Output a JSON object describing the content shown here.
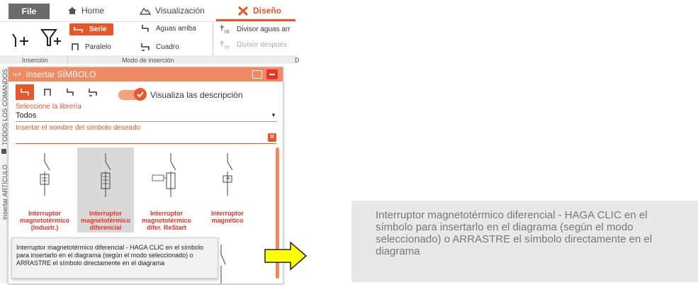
{
  "ribbon": {
    "file_tab": "File",
    "tabs": [
      {
        "label": "Home",
        "icon": "home-icon"
      },
      {
        "label": "Visualización",
        "icon": "mountain-icon"
      },
      {
        "label": "Diseño",
        "icon": "tools-icon"
      }
    ],
    "insert_mode_options": {
      "serie": "Serie",
      "paralelo": "Paralelo",
      "aguas_arriba": "Aguas arriba",
      "cuadro": "Cuadro",
      "divisor_aguas_arriba": "Divisor aguas arr",
      "divisor_despues": "Divisor después"
    },
    "groups": {
      "insercion": "Inserción",
      "modo_insercion": "Modo de inserción"
    }
  },
  "side_tabs": {
    "commands": "TODOS LOS COMANDOS",
    "insert_article": "Insertar ARTÍCULO"
  },
  "panel": {
    "title": "Insertar SÍMBOLO",
    "toggle_label": "Visualiza las descripción",
    "library_label": "Seleccione la librería",
    "library_value": "Todos",
    "search_placeholder": "Insertar el nombre del símbolo deseado",
    "symbols": [
      {
        "name_lines": [
          "Interruptor",
          "magnetotérmico",
          "(Industr.)"
        ]
      },
      {
        "name_lines": [
          "Interruptor",
          "magnetotérmico",
          "diferencial"
        ]
      },
      {
        "name_lines": [
          "Interruptor",
          "magnetotérmico",
          "difer. ReStart"
        ]
      },
      {
        "name_lines": [
          "Interruptor",
          "magnético",
          ""
        ]
      }
    ],
    "tooltip": "Interruptor magnetotérmico diferencial - HAGA CLIC en el símbolo para insertarlo en el diagrama (según el modo seleccionado) o ARRASTRE el símbolo directamente en el diagrama"
  },
  "zoom_callout": {
    "text": "Interruptor magnetotérmico diferencial - HAGA CLIC en el símbolo para insertarlo en el diagrama (según el modo seleccionado) o ARRASTRE el símbolo directamente en el diagrama"
  },
  "colors": {
    "accent": "#e8562b",
    "header": "#ef8a63",
    "arrow": "#ffff00"
  }
}
